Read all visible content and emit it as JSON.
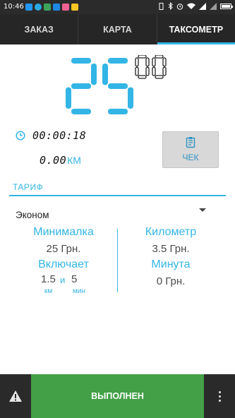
{
  "status_bar": {
    "time": "10:46",
    "left_icons": [
      "notification-icon-blue",
      "notification-icon-skype",
      "notification-icon-green",
      "notification-icon-gallery",
      "notification-icon-pink",
      "notification-icon-yellow"
    ],
    "right_icons": [
      "vibrate-icon",
      "bluetooth-icon",
      "alarm-icon",
      "wifi-icon",
      "signal-icon",
      "signal-icon-2",
      "battery-icon"
    ]
  },
  "tabs": [
    {
      "label": "ЗАКАЗ",
      "active": false
    },
    {
      "label": "КАРТА",
      "active": false
    },
    {
      "label": "ТАКСОМЕТР",
      "active": true
    }
  ],
  "meter": {
    "main_value": "25",
    "fraction_value": "00",
    "elapsed_time": "00:00:18",
    "distance": "0.00",
    "distance_unit": "КМ"
  },
  "check_button": {
    "label": "ЧЕК"
  },
  "tariff": {
    "header": "ТАРИФ",
    "selected": "Эконом",
    "minimum_title": "Минималка",
    "minimum_value": "25 Грн.",
    "includes_title": "Включает",
    "includes_km": "1.5",
    "includes_and": "и",
    "includes_min": "5",
    "includes_km_unit": "км",
    "includes_min_unit": "мин",
    "km_title": "Километр",
    "km_value": "3.5 Грн.",
    "minute_title": "Минута",
    "minute_value": "0 Грн."
  },
  "bottom": {
    "done_label": "ВЫПОЛНЕН"
  },
  "colors": {
    "accent": "#33b5e5",
    "done_green": "#43a047",
    "dark_bar": "#262626"
  }
}
